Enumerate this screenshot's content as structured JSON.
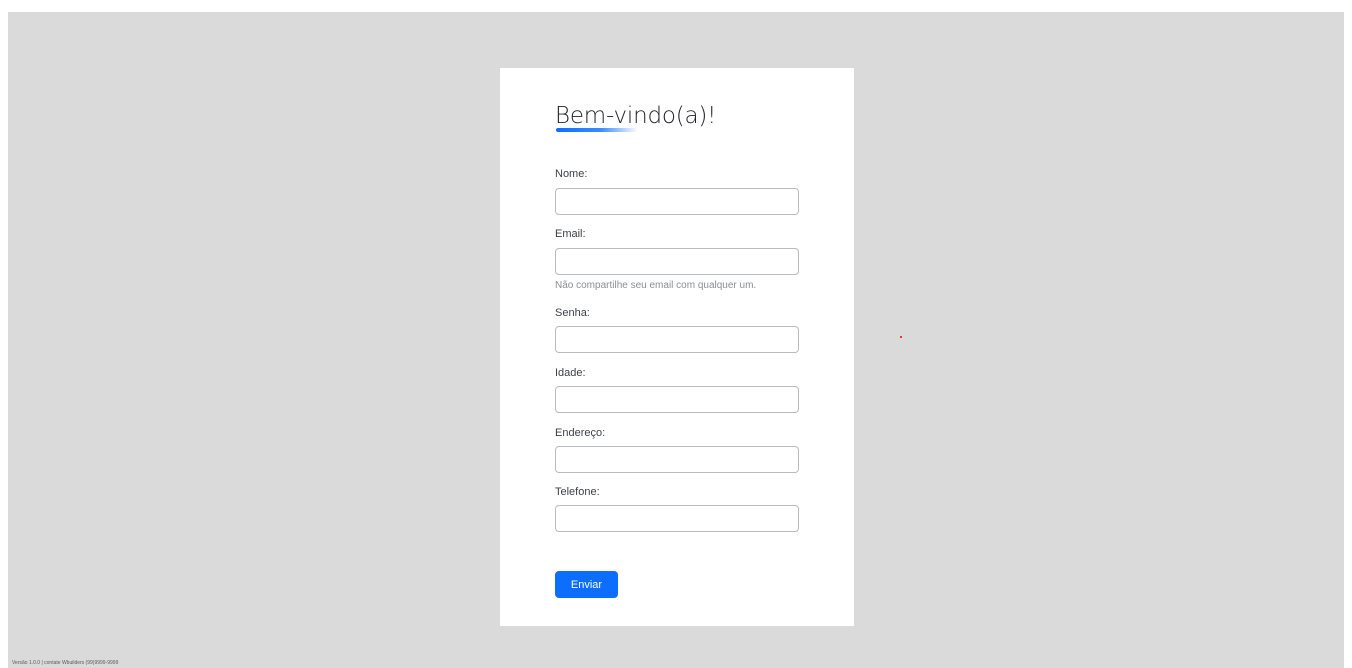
{
  "page": {
    "title": "Bem-vindo(a)!",
    "background_color": "#dadada",
    "card_color": "#ffffff",
    "accent_color": "#0d6efd"
  },
  "form": {
    "fields": [
      {
        "label": "Nome:",
        "value": "",
        "placeholder": "",
        "type": "text"
      },
      {
        "label": "Email:",
        "value": "",
        "placeholder": "",
        "type": "email",
        "help": "Não compartilhe seu email com qualquer um."
      },
      {
        "label": "Senha:",
        "value": "",
        "placeholder": "",
        "type": "password"
      },
      {
        "label": "Idade:",
        "value": "",
        "placeholder": "",
        "type": "text"
      },
      {
        "label": "Endereço:",
        "value": "",
        "placeholder": "",
        "type": "text"
      },
      {
        "label": "Telefone:",
        "value": "",
        "placeholder": "",
        "type": "text"
      }
    ],
    "submit_label": "Enviar"
  },
  "footer": {
    "text": "Versão 1.0.0 | contate Wbuilders (99)9999-9999"
  }
}
